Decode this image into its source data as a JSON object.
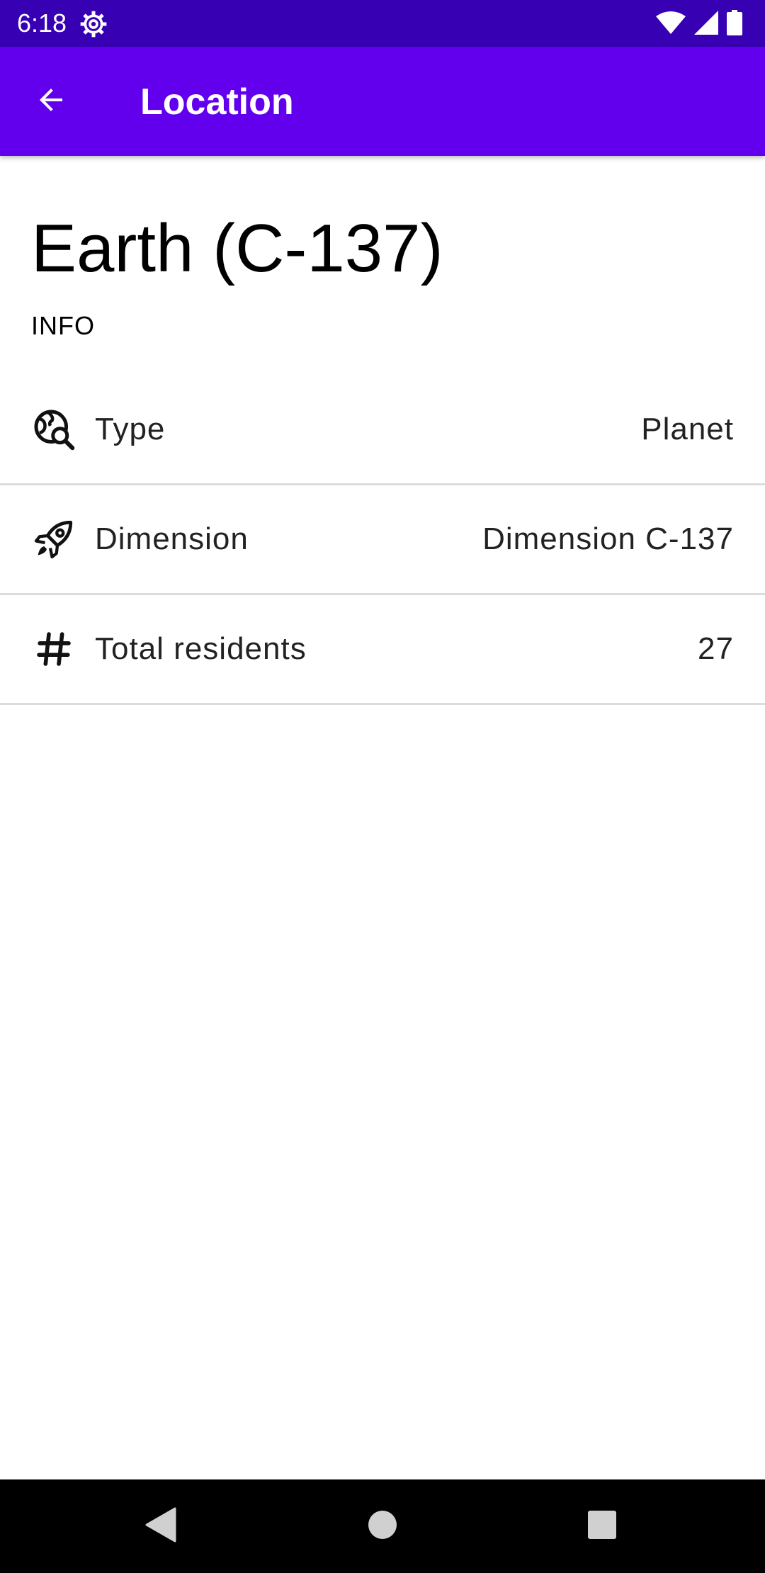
{
  "status_bar": {
    "time": "6:18",
    "icons": [
      "settings-gear-icon",
      "wifi-icon",
      "cellular-signal-icon",
      "battery-icon"
    ],
    "background": "#3700b3"
  },
  "app_bar": {
    "title": "Location",
    "back_icon": "arrow-back-icon",
    "background": "#6200ee"
  },
  "location": {
    "name": "Earth (C-137)",
    "section_header": "INFO",
    "rows": [
      {
        "icon": "globe-search-icon",
        "label": "Type",
        "value": "Planet"
      },
      {
        "icon": "rocket-icon",
        "label": "Dimension",
        "value": "Dimension C-137"
      },
      {
        "icon": "hash-icon",
        "label": "Total residents",
        "value": "27"
      }
    ]
  },
  "nav_bar": {
    "buttons": [
      "back-triangle-icon",
      "home-circle-icon",
      "recents-square-icon"
    ]
  }
}
